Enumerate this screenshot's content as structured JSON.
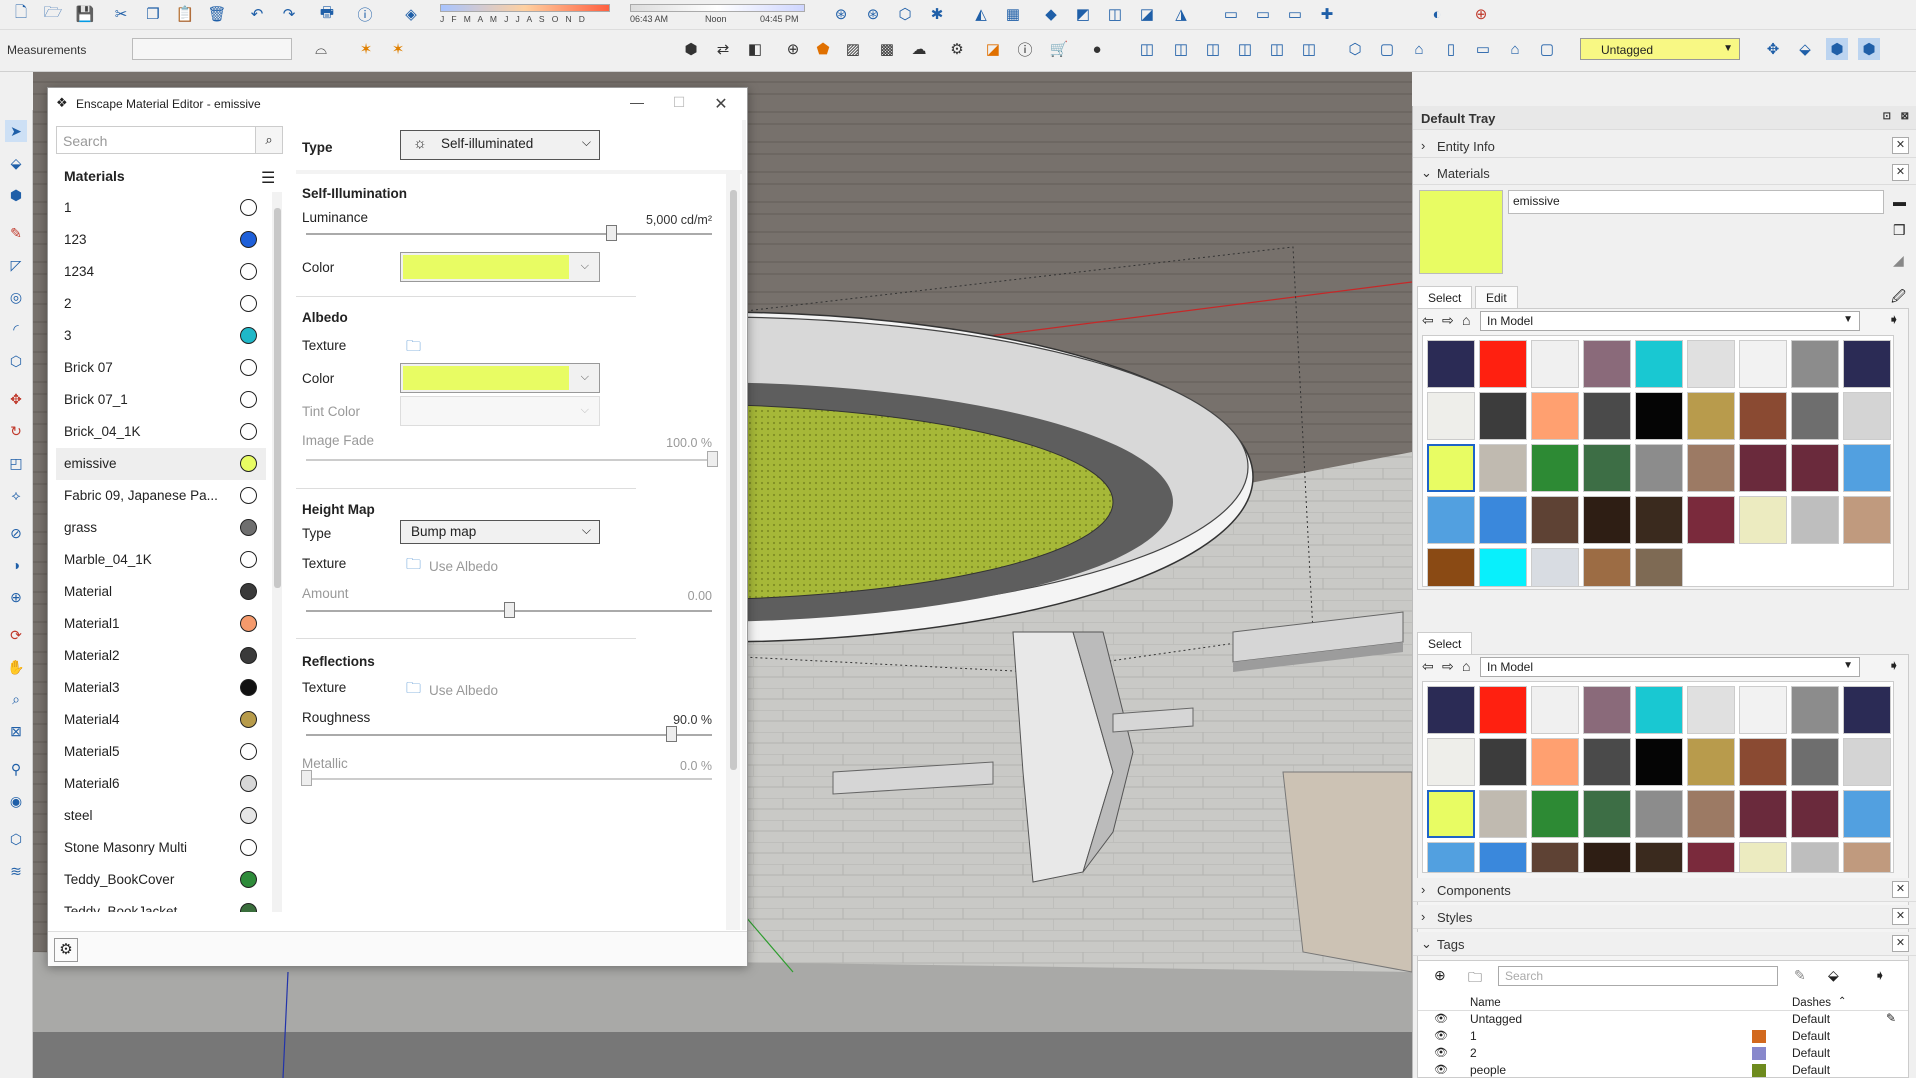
{
  "top_bar": {
    "sun_months": "J F M A M J J A S O N D",
    "time_start": "06:43 AM",
    "time_mid": "Noon",
    "time_end": "04:45 PM"
  },
  "measurements": {
    "label": "Measurements",
    "value": ""
  },
  "tag_selector": {
    "value": "Untagged"
  },
  "editor": {
    "title": "Enscape Material Editor - emissive",
    "search_placeholder": "Search",
    "materials_header": "Materials",
    "materials": [
      {
        "name": "1",
        "swatch": "#ffffff"
      },
      {
        "name": "123",
        "swatch": "#1e5fd9"
      },
      {
        "name": "1234",
        "swatch": "#ffffff"
      },
      {
        "name": "2",
        "swatch": "#ffffff"
      },
      {
        "name": "3",
        "swatch": "#1fb8c8"
      },
      {
        "name": "Brick 07",
        "swatch": "#ffffff"
      },
      {
        "name": "Brick 07_1",
        "swatch": "#ffffff"
      },
      {
        "name": "Brick_04_1K",
        "swatch": "#ffffff"
      },
      {
        "name": "emissive",
        "swatch": "#e8fc63"
      },
      {
        "name": "Fabric 09, Japanese Pa...",
        "swatch": "#ffffff"
      },
      {
        "name": "grass",
        "swatch": "#6e6e6e"
      },
      {
        "name": "Marble_04_1K",
        "swatch": "#ffffff"
      },
      {
        "name": "Material",
        "swatch": "#3a3a3a"
      },
      {
        "name": "Material1",
        "swatch": "#f59a6c"
      },
      {
        "name": "Material2",
        "swatch": "#3a3a3a"
      },
      {
        "name": "Material3",
        "swatch": "#111111"
      },
      {
        "name": "Material4",
        "swatch": "#b79b4a"
      },
      {
        "name": "Material5",
        "swatch": "#ffffff"
      },
      {
        "name": "Material6",
        "swatch": "#d7d7d7"
      },
      {
        "name": "steel",
        "swatch": "#e6e6e6"
      },
      {
        "name": "Stone Masonry Multi",
        "swatch": "#ffffff"
      },
      {
        "name": "Teddy_BookCover",
        "swatch": "#2e8b3a"
      },
      {
        "name": "Teddy_BookJacket",
        "swatch": "#3a6e3c"
      }
    ],
    "type_label": "Type",
    "type_value": "Self-illuminated",
    "self_illum": {
      "title": "Self-Illumination",
      "luminance_label": "Luminance",
      "luminance_value": "5,000 cd/m²",
      "luminance_level": 0.75,
      "color_label": "Color",
      "color": "#e8fc63"
    },
    "albedo": {
      "title": "Albedo",
      "texture_label": "Texture",
      "color_label": "Color",
      "color": "#e8fc63",
      "tint_label": "Tint Color",
      "fade_label": "Image Fade",
      "fade_value": "100.0 %",
      "fade_level": 1.0
    },
    "height_map": {
      "title": "Height Map",
      "type_label": "Type",
      "type_value": "Bump map",
      "texture_label": "Texture",
      "texture_value": "Use Albedo",
      "amount_label": "Amount",
      "amount_value": "0.00",
      "amount_level": 0.5
    },
    "reflections": {
      "title": "Reflections",
      "texture_label": "Texture",
      "texture_value": "Use Albedo",
      "roughness_label": "Roughness",
      "roughness_value": "90.0 %",
      "roughness_level": 0.9,
      "metallic_label": "Metallic",
      "metallic_value": "0.0 %",
      "metallic_level": 0.0
    }
  },
  "tray": {
    "title": "Default Tray",
    "entity_info": "Entity Info",
    "materials": "Materials",
    "material_name": "emissive",
    "select_tab": "Select",
    "edit_tab": "Edit",
    "collection": "In Model",
    "components": "Components",
    "styles": "Styles",
    "tags": "Tags",
    "tags_search": "Search",
    "col_name": "Name",
    "col_dashes": "Dashes",
    "tag_rows": [
      {
        "name": "Untagged",
        "dashes": "Default",
        "color": ""
      },
      {
        "name": "1",
        "dashes": "Default",
        "color": "#d2691e"
      },
      {
        "name": "2",
        "dashes": "Default",
        "color": "#8888cc"
      },
      {
        "name": "people",
        "dashes": "Default",
        "color": "#6e8b1e"
      }
    ],
    "swatches": [
      "#2b2b55",
      "#ff2010",
      "#f0f0f0",
      "#8a6a7a",
      "#19c8d2",
      "#e0e0e0",
      "#f2f2f2",
      "#8c8c8c",
      "#2b2b55",
      "#eeeeea",
      "#3c3c3c",
      "#ffa070",
      "#4a4a4a",
      "#050505",
      "#b89b4c",
      "#8a4a32",
      "#6e6e6e",
      "#d4d4d4",
      "#e8fc63",
      "#c0bab0",
      "#2d8a34",
      "#3d6e45",
      "#8c8c8c",
      "#9c7a64",
      "#6a2a3c",
      "#6a2a3c",
      "#52a0e0",
      "#52a0e0",
      "#3a88dc",
      "#5e4234",
      "#2e1e14",
      "#3a2a1e",
      "#7a2a3c",
      "#ecebc0",
      "#bebebe",
      "#c09a7e",
      "#8a4a14",
      "#08f0fc",
      "#d8dce2",
      "#9c6c44",
      "#7e6a54"
    ]
  }
}
